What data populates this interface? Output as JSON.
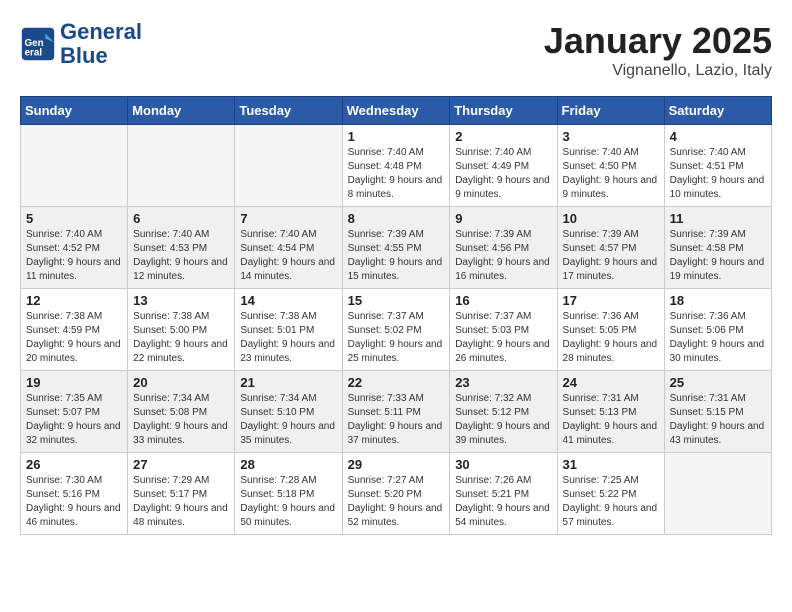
{
  "header": {
    "logo_line1": "General",
    "logo_line2": "Blue",
    "month_title": "January 2025",
    "location": "Vignanello, Lazio, Italy"
  },
  "days_of_week": [
    "Sunday",
    "Monday",
    "Tuesday",
    "Wednesday",
    "Thursday",
    "Friday",
    "Saturday"
  ],
  "weeks": [
    [
      {
        "day": "",
        "info": ""
      },
      {
        "day": "",
        "info": ""
      },
      {
        "day": "",
        "info": ""
      },
      {
        "day": "1",
        "info": "Sunrise: 7:40 AM\nSunset: 4:48 PM\nDaylight: 9 hours and 8 minutes."
      },
      {
        "day": "2",
        "info": "Sunrise: 7:40 AM\nSunset: 4:49 PM\nDaylight: 9 hours and 9 minutes."
      },
      {
        "day": "3",
        "info": "Sunrise: 7:40 AM\nSunset: 4:50 PM\nDaylight: 9 hours and 9 minutes."
      },
      {
        "day": "4",
        "info": "Sunrise: 7:40 AM\nSunset: 4:51 PM\nDaylight: 9 hours and 10 minutes."
      }
    ],
    [
      {
        "day": "5",
        "info": "Sunrise: 7:40 AM\nSunset: 4:52 PM\nDaylight: 9 hours and 11 minutes."
      },
      {
        "day": "6",
        "info": "Sunrise: 7:40 AM\nSunset: 4:53 PM\nDaylight: 9 hours and 12 minutes."
      },
      {
        "day": "7",
        "info": "Sunrise: 7:40 AM\nSunset: 4:54 PM\nDaylight: 9 hours and 14 minutes."
      },
      {
        "day": "8",
        "info": "Sunrise: 7:39 AM\nSunset: 4:55 PM\nDaylight: 9 hours and 15 minutes."
      },
      {
        "day": "9",
        "info": "Sunrise: 7:39 AM\nSunset: 4:56 PM\nDaylight: 9 hours and 16 minutes."
      },
      {
        "day": "10",
        "info": "Sunrise: 7:39 AM\nSunset: 4:57 PM\nDaylight: 9 hours and 17 minutes."
      },
      {
        "day": "11",
        "info": "Sunrise: 7:39 AM\nSunset: 4:58 PM\nDaylight: 9 hours and 19 minutes."
      }
    ],
    [
      {
        "day": "12",
        "info": "Sunrise: 7:38 AM\nSunset: 4:59 PM\nDaylight: 9 hours and 20 minutes."
      },
      {
        "day": "13",
        "info": "Sunrise: 7:38 AM\nSunset: 5:00 PM\nDaylight: 9 hours and 22 minutes."
      },
      {
        "day": "14",
        "info": "Sunrise: 7:38 AM\nSunset: 5:01 PM\nDaylight: 9 hours and 23 minutes."
      },
      {
        "day": "15",
        "info": "Sunrise: 7:37 AM\nSunset: 5:02 PM\nDaylight: 9 hours and 25 minutes."
      },
      {
        "day": "16",
        "info": "Sunrise: 7:37 AM\nSunset: 5:03 PM\nDaylight: 9 hours and 26 minutes."
      },
      {
        "day": "17",
        "info": "Sunrise: 7:36 AM\nSunset: 5:05 PM\nDaylight: 9 hours and 28 minutes."
      },
      {
        "day": "18",
        "info": "Sunrise: 7:36 AM\nSunset: 5:06 PM\nDaylight: 9 hours and 30 minutes."
      }
    ],
    [
      {
        "day": "19",
        "info": "Sunrise: 7:35 AM\nSunset: 5:07 PM\nDaylight: 9 hours and 32 minutes."
      },
      {
        "day": "20",
        "info": "Sunrise: 7:34 AM\nSunset: 5:08 PM\nDaylight: 9 hours and 33 minutes."
      },
      {
        "day": "21",
        "info": "Sunrise: 7:34 AM\nSunset: 5:10 PM\nDaylight: 9 hours and 35 minutes."
      },
      {
        "day": "22",
        "info": "Sunrise: 7:33 AM\nSunset: 5:11 PM\nDaylight: 9 hours and 37 minutes."
      },
      {
        "day": "23",
        "info": "Sunrise: 7:32 AM\nSunset: 5:12 PM\nDaylight: 9 hours and 39 minutes."
      },
      {
        "day": "24",
        "info": "Sunrise: 7:31 AM\nSunset: 5:13 PM\nDaylight: 9 hours and 41 minutes."
      },
      {
        "day": "25",
        "info": "Sunrise: 7:31 AM\nSunset: 5:15 PM\nDaylight: 9 hours and 43 minutes."
      }
    ],
    [
      {
        "day": "26",
        "info": "Sunrise: 7:30 AM\nSunset: 5:16 PM\nDaylight: 9 hours and 46 minutes."
      },
      {
        "day": "27",
        "info": "Sunrise: 7:29 AM\nSunset: 5:17 PM\nDaylight: 9 hours and 48 minutes."
      },
      {
        "day": "28",
        "info": "Sunrise: 7:28 AM\nSunset: 5:18 PM\nDaylight: 9 hours and 50 minutes."
      },
      {
        "day": "29",
        "info": "Sunrise: 7:27 AM\nSunset: 5:20 PM\nDaylight: 9 hours and 52 minutes."
      },
      {
        "day": "30",
        "info": "Sunrise: 7:26 AM\nSunset: 5:21 PM\nDaylight: 9 hours and 54 minutes."
      },
      {
        "day": "31",
        "info": "Sunrise: 7:25 AM\nSunset: 5:22 PM\nDaylight: 9 hours and 57 minutes."
      },
      {
        "day": "",
        "info": ""
      }
    ]
  ],
  "shaded_rows": [
    1,
    3
  ]
}
